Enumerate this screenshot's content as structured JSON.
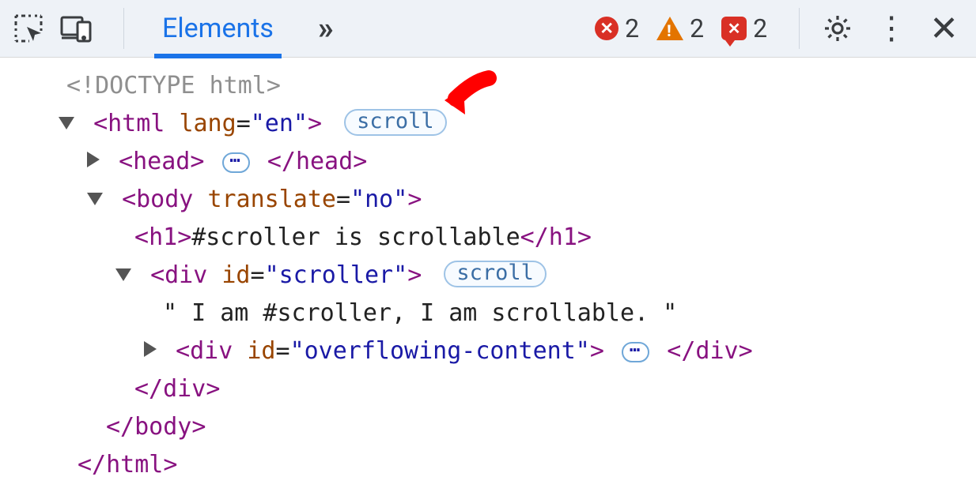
{
  "toolbar": {
    "active_tab": "Elements",
    "more_glyph": "»",
    "errors": {
      "count": "2",
      "glyph": "✕"
    },
    "warnings": {
      "count": "2"
    },
    "issues": {
      "count": "2",
      "glyph": "✕"
    },
    "kebab_glyph": "⋮",
    "close_glyph": "✕"
  },
  "tree": {
    "doctype": "<!DOCTYPE html>",
    "html_open_tag": "html",
    "html_open_lang_attr": "lang",
    "html_open_lang_val": "\"en\"",
    "scroll_badge": "scroll",
    "head_tag": "head",
    "ellipsis": "⋯",
    "body_open_tag": "body",
    "body_translate_attr": "translate",
    "body_translate_val": "\"no\"",
    "h1_tag": "h1",
    "h1_text": "#scroller is scrollable",
    "div1_tag": "div",
    "div1_id_attr": "id",
    "div1_id_val": "\"scroller\"",
    "text_node": "\" I am #scroller, I am scrollable. \"",
    "div2_tag": "div",
    "div2_id_attr": "id",
    "div2_id_val": "\"overflowing-content\"",
    "div_close": "div",
    "body_close": "body",
    "html_close": "html"
  }
}
